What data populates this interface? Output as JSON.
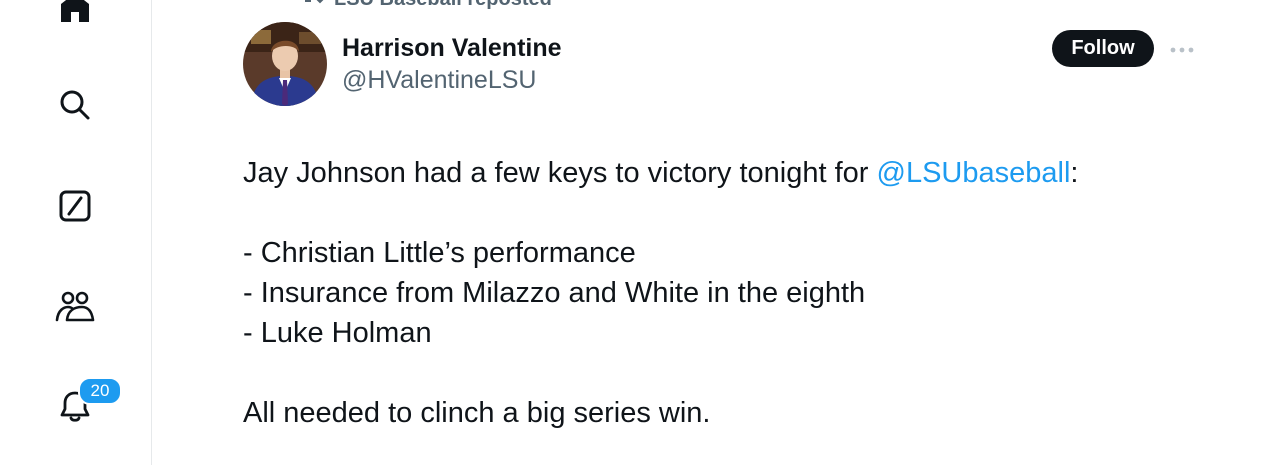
{
  "sidebar": {
    "items": [
      {
        "icon": "home-icon"
      },
      {
        "icon": "search-icon"
      },
      {
        "icon": "grok-icon"
      },
      {
        "icon": "communities-icon"
      },
      {
        "icon": "notifications-icon",
        "badge": "20"
      }
    ]
  },
  "tweet": {
    "repost_label": "LSU Baseball reposted",
    "author": {
      "display_name": "Harrison Valentine",
      "handle": "@HValentineLSU"
    },
    "follow_label": "Follow",
    "text": {
      "line1_prefix": "Jay Johnson had a few keys to victory tonight for ",
      "line1_mention": "@LSUbaseball",
      "line1_suffix": ":",
      "bullets": [
        "- Christian Little’s performance",
        "- Insurance from Milazzo and White in the eighth",
        "- Luke Holman"
      ],
      "closing": "All needed to clinch a big series win."
    }
  },
  "colors": {
    "accent": "#1d9bf0",
    "text_primary": "#0f1419",
    "text_secondary": "#536471",
    "follow_bg": "#0f1419",
    "divider": "#e6e9eb"
  }
}
